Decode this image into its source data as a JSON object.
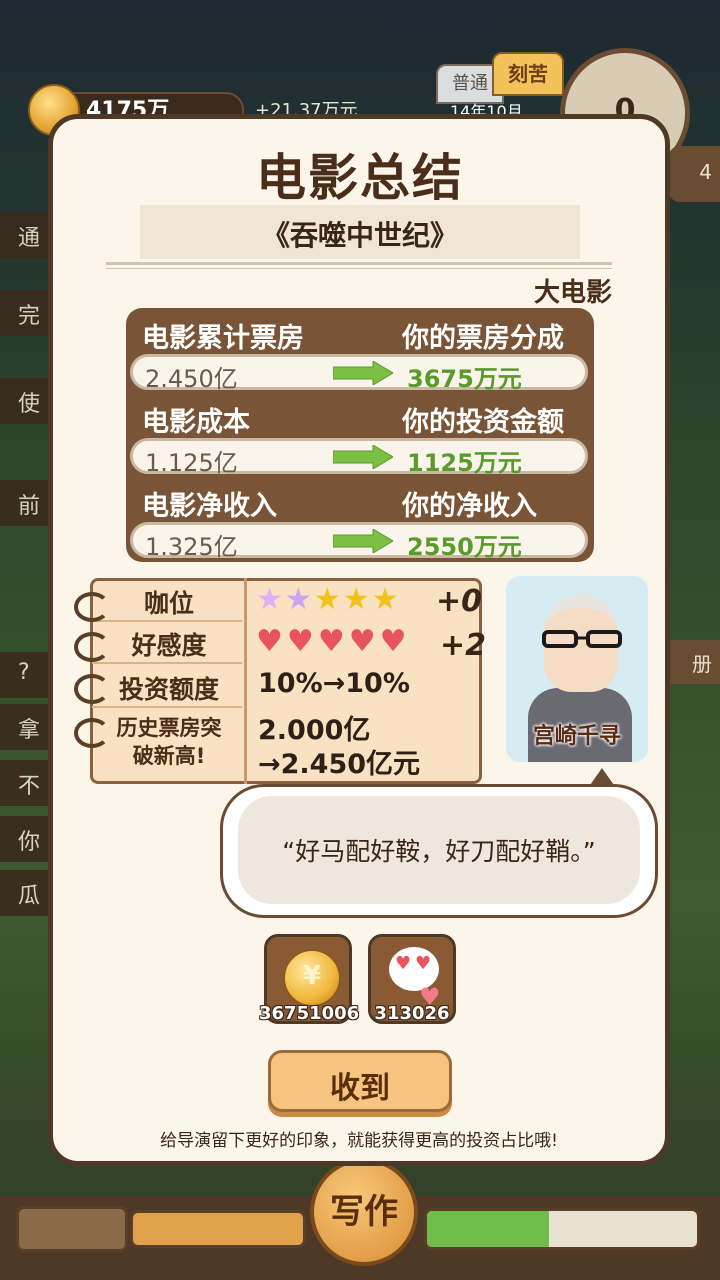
{
  "background": {
    "money": "4175万",
    "gain": "+21.37万元",
    "difficulty_tabs": [
      "普通",
      "刻苦"
    ],
    "date": "14年10月",
    "clock_value": "0",
    "side_right_badge": "4",
    "left_side_chars": [
      "通",
      "完",
      "使",
      "前",
      "?",
      "拿",
      "不",
      "你",
      "瓜"
    ],
    "right_side_label": "册",
    "bottom_center_label": "写作",
    "bottom_progress": 0.45
  },
  "modal": {
    "title": "电影总结",
    "movie_name": "《吞噬中世纪》",
    "movie_type": "大电影",
    "stats": [
      {
        "left_label": "电影累计票房",
        "right_label": "你的票房分成",
        "value": "2.450亿",
        "result": "3675万元"
      },
      {
        "left_label": "电影成本",
        "right_label": "你的投资金额",
        "value": "1.125亿",
        "result": "1125万元"
      },
      {
        "left_label": "电影净收入",
        "right_label": "你的净收入",
        "value": "1.325亿",
        "result": "2550万元"
      }
    ],
    "notebook": {
      "rank_label": "咖位",
      "rank_stars_filled": 5,
      "rank_bonus": "+0",
      "favor_label": "好感度",
      "favor_hearts": 5,
      "favor_bonus": "+2",
      "invest_label": "投资额度",
      "invest_value": "10%→10%",
      "record_label_line1": "历史票房突",
      "record_label_line2": "破新高!",
      "record_value_line1": "2.000亿",
      "record_value_line2": "→2.450亿元"
    },
    "director": {
      "name": "宫崎千寻"
    },
    "quote": "“好马配好鞍，好刀配好鞘。”",
    "rewards": [
      {
        "icon": "gold-coin-icon",
        "glyph": "¥",
        "amount": "36751006"
      },
      {
        "icon": "heart-eyes-ghost-icon",
        "amount": "313026"
      }
    ],
    "confirm_label": "收到",
    "hint": "给导演留下更好的印象，就能获得更高的投资占比哦!"
  },
  "colors": {
    "modal_bg": "#fcf6ea",
    "board_brown": "#7a5436",
    "result_green": "#5a9b2e",
    "arrow_green": "#7bc043",
    "heart_red": "#e8545e",
    "star_gold": "#f2c21a",
    "star_rainbow": "#c9a6f0"
  }
}
